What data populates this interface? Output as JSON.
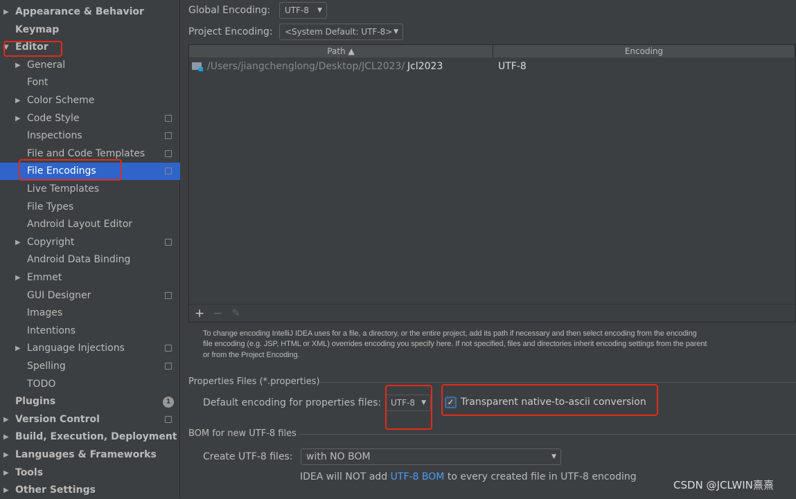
{
  "sidebar": {
    "items": [
      {
        "label": "Appearance & Behavior",
        "level": 0,
        "arrow": "right",
        "bold": true
      },
      {
        "label": "Keymap",
        "level": 0,
        "bold": true
      },
      {
        "label": "Editor",
        "level": 0,
        "arrow": "down",
        "bold": true
      },
      {
        "label": "General",
        "level": 1,
        "arrow": "right"
      },
      {
        "label": "Font",
        "level": 1
      },
      {
        "label": "Color Scheme",
        "level": 1,
        "arrow": "right"
      },
      {
        "label": "Code Style",
        "level": 1,
        "arrow": "right",
        "copy": true
      },
      {
        "label": "Inspections",
        "level": 1,
        "copy": true
      },
      {
        "label": "File and Code Templates",
        "level": 1,
        "copy": true
      },
      {
        "label": "File Encodings",
        "level": 1,
        "copy": true,
        "selected": true
      },
      {
        "label": "Live Templates",
        "level": 1
      },
      {
        "label": "File Types",
        "level": 1
      },
      {
        "label": "Android Layout Editor",
        "level": 1
      },
      {
        "label": "Copyright",
        "level": 1,
        "arrow": "right",
        "copy": true
      },
      {
        "label": "Android Data Binding",
        "level": 1
      },
      {
        "label": "Emmet",
        "level": 1,
        "arrow": "right"
      },
      {
        "label": "GUI Designer",
        "level": 1,
        "copy": true
      },
      {
        "label": "Images",
        "level": 1
      },
      {
        "label": "Intentions",
        "level": 1
      },
      {
        "label": "Language Injections",
        "level": 1,
        "arrow": "right",
        "copy": true
      },
      {
        "label": "Spelling",
        "level": 1,
        "copy": true
      },
      {
        "label": "TODO",
        "level": 1
      },
      {
        "label": "Plugins",
        "level": 0,
        "bold": true,
        "badge": "1"
      },
      {
        "label": "Version Control",
        "level": 0,
        "arrow": "right",
        "bold": true,
        "copy": true
      },
      {
        "label": "Build, Execution, Deployment",
        "level": 0,
        "arrow": "right",
        "bold": true
      },
      {
        "label": "Languages & Frameworks",
        "level": 0,
        "arrow": "right",
        "bold": true
      },
      {
        "label": "Tools",
        "level": 0,
        "arrow": "right",
        "bold": true
      },
      {
        "label": "Other Settings",
        "level": 0,
        "arrow": "right",
        "bold": true
      }
    ]
  },
  "main": {
    "global_label": "Global Encoding:",
    "global_value": "UTF-8",
    "project_label": "Project Encoding:",
    "project_value": "<System Default: UTF-8>",
    "table": {
      "headers": [
        "Path ▲",
        "Encoding"
      ],
      "rows": [
        {
          "path_prefix": "/Users/jiangchenglong/Desktop/JCL2023/",
          "path_name": "Jcl2023",
          "encoding": "UTF-8"
        }
      ]
    },
    "toolbar": {
      "add": "+",
      "remove": "−",
      "edit": "✎"
    },
    "help": [
      "To change encoding IntelliJ IDEA uses for a file, a directory, or the entire project, add its path if necessary and then select encoding from the encoding",
      "file encoding (e.g. JSP, HTML or XML) overrides encoding you specify here. If not specified, files and directories inherit encoding settings from the parent",
      "or from the Project Encoding."
    ],
    "properties_section": "Properties Files (*.properties)",
    "default_label": "Default encoding for properties files:",
    "default_value": "UTF-8",
    "transparent_label": "Transparent native-to-ascii conversion",
    "transparent_checked": true,
    "bom_section": "BOM for new UTF-8 files",
    "create_label": "Create UTF-8 files:",
    "create_value": "with NO BOM",
    "note_a": "IDEA will NOT add ",
    "note_link": "UTF-8 BOM",
    "note_b": " to every created file in UTF-8 encoding"
  },
  "watermark": "CSDN @JCLWIN熹熹",
  "colors": {
    "selection": "#2f65ca",
    "highlight": "#e52a1b",
    "link": "#4b9df5"
  }
}
